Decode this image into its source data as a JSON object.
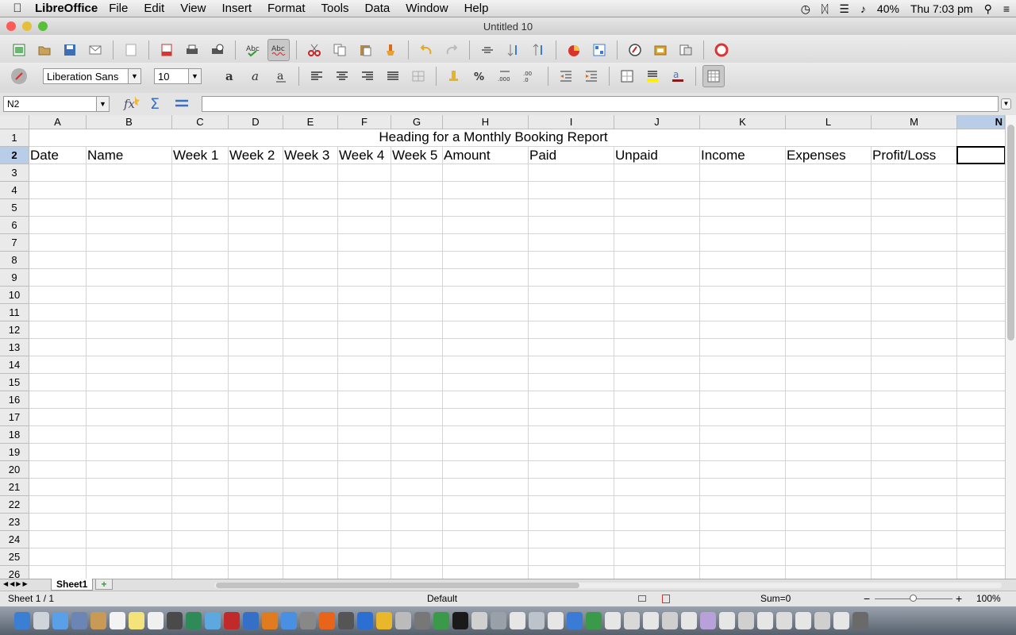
{
  "menubar": {
    "app_name": "LibreOffice",
    "items": [
      "File",
      "Edit",
      "View",
      "Insert",
      "Format",
      "Tools",
      "Data",
      "Window",
      "Help"
    ],
    "battery": "40%",
    "clock": "Thu 7:03 pm"
  },
  "window": {
    "title": "Untitled 10"
  },
  "toolbar": {
    "font_name": "Liberation Sans",
    "font_size": "10"
  },
  "formula_bar": {
    "cell_reference": "N2",
    "content": ""
  },
  "columns": [
    "A",
    "B",
    "C",
    "D",
    "E",
    "F",
    "G",
    "H",
    "I",
    "J",
    "K",
    "L",
    "M",
    "N"
  ],
  "rows": [
    "1",
    "2",
    "3",
    "4",
    "5",
    "6",
    "7",
    "8",
    "9",
    "10",
    "11",
    "12",
    "13",
    "14",
    "15",
    "16",
    "17",
    "18",
    "19",
    "20",
    "21",
    "22",
    "23",
    "24",
    "25",
    "26"
  ],
  "sheet": {
    "title": "Heading for a Monthly Booking Report",
    "headers": [
      "Date",
      "Name",
      "Week 1",
      "Week 2",
      "Week 3",
      "Week 4",
      "Week 5",
      "Amount",
      "Paid",
      "Unpaid",
      "Income",
      "Expenses",
      "Profit/Loss"
    ]
  },
  "tabs": {
    "sheet_name": "Sheet1"
  },
  "statusbar": {
    "sheet_info": "Sheet 1 / 1",
    "page_style": "Default",
    "sum": "Sum=0",
    "zoom": "100%"
  },
  "colors": {
    "selection": "#0070c0",
    "header_highlight": "#b8cde8"
  }
}
